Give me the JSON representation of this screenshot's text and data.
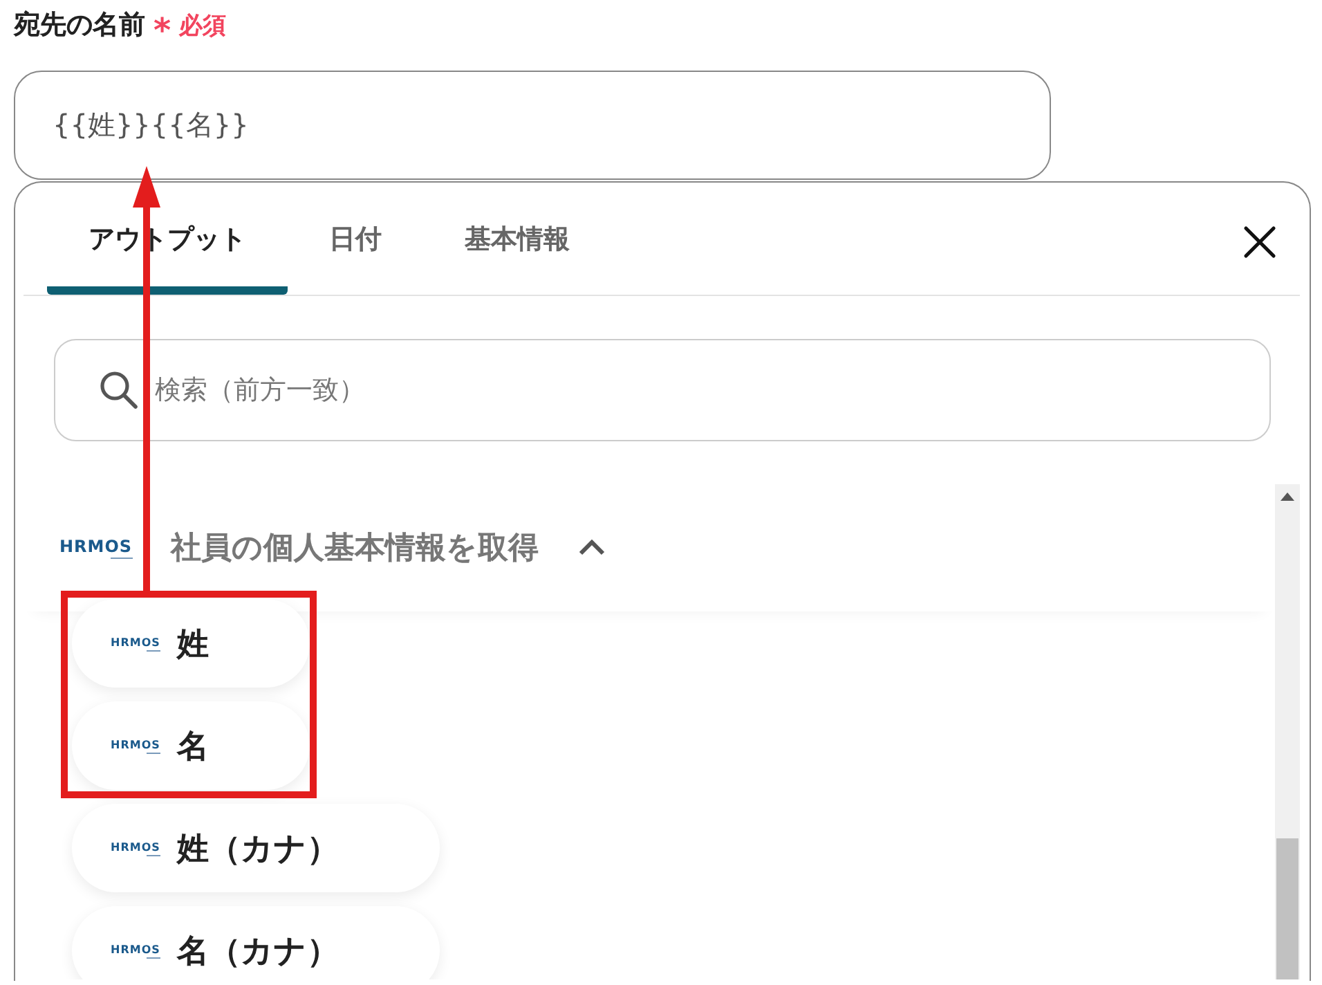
{
  "field": {
    "label": "宛先の名前",
    "required_mark": "*",
    "required_text": "必須",
    "value": "{{姓}}{{名}}"
  },
  "panel": {
    "tabs": [
      {
        "label": "アウトプット",
        "selected": true
      },
      {
        "label": "日付",
        "selected": false
      },
      {
        "label": "基本情報",
        "selected": false
      }
    ],
    "search": {
      "placeholder": "検索（前方一致）"
    },
    "group": {
      "logo": "HRMOS",
      "title": "社員の個人基本情報を取得",
      "expanded": true,
      "items": [
        {
          "logo": "HRMOS",
          "label": "姓",
          "highlighted": true
        },
        {
          "logo": "HRMOS",
          "label": "名",
          "highlighted": true
        },
        {
          "logo": "HRMOS",
          "label": "姓（カナ）",
          "highlighted": false
        },
        {
          "logo": "HRMOS",
          "label": "名（カナ）",
          "highlighted": false
        }
      ]
    }
  }
}
